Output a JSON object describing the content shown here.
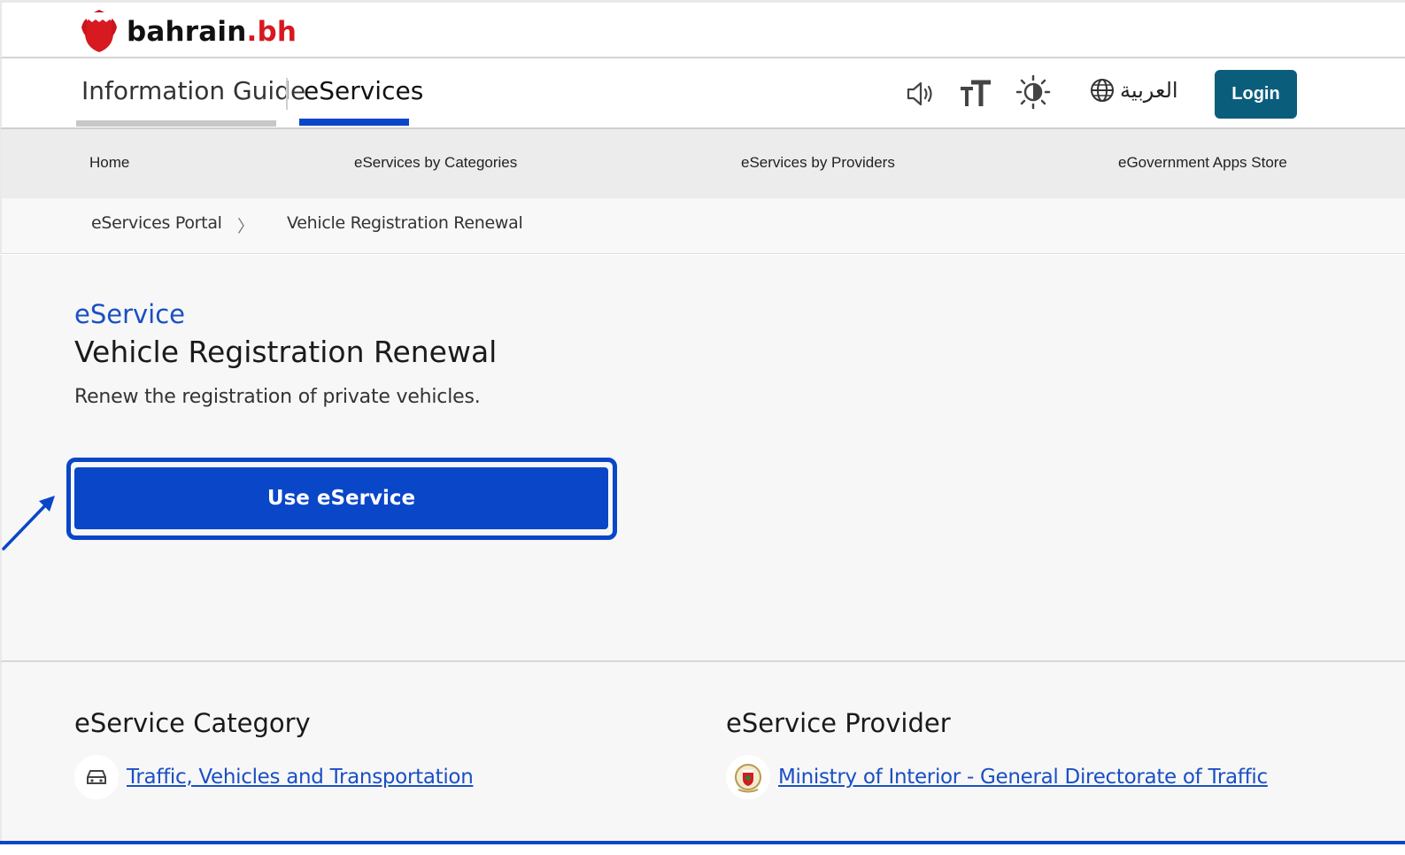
{
  "brand": {
    "name_main": "bahrain",
    "name_suffix": ".bh"
  },
  "main_nav": {
    "tabs": [
      {
        "label": "Information Guide",
        "active": false
      },
      {
        "label": "eServices",
        "active": true
      }
    ],
    "tools": [
      "speaker-icon",
      "text-size-icon",
      "contrast-icon"
    ],
    "language_label": "العربية",
    "login_label": "Login"
  },
  "secondary_nav": {
    "items": [
      {
        "label": "Home"
      },
      {
        "label": "eServices by Categories"
      },
      {
        "label": "eServices by Providers"
      },
      {
        "label": "eGovernment Apps Store"
      }
    ]
  },
  "breadcrumb": {
    "items": [
      {
        "label": "eServices Portal"
      },
      {
        "label": "Vehicle Registration Renewal"
      }
    ],
    "separator": "〉"
  },
  "service": {
    "eyebrow": "eService",
    "title": "Vehicle Registration Renewal",
    "description": "Renew the registration of private vehicles.",
    "cta_label": "Use eService"
  },
  "category": {
    "heading": "eService Category",
    "link_label": "Traffic, Vehicles and Transportation"
  },
  "provider": {
    "heading": "eService Provider",
    "link_label": "Ministry of Interior - General Directorate of Traffic"
  },
  "colors": {
    "accent": "#0a46c8",
    "login": "#0b5d7c",
    "brand_red": "#d71920",
    "link": "#1a4fc4"
  }
}
